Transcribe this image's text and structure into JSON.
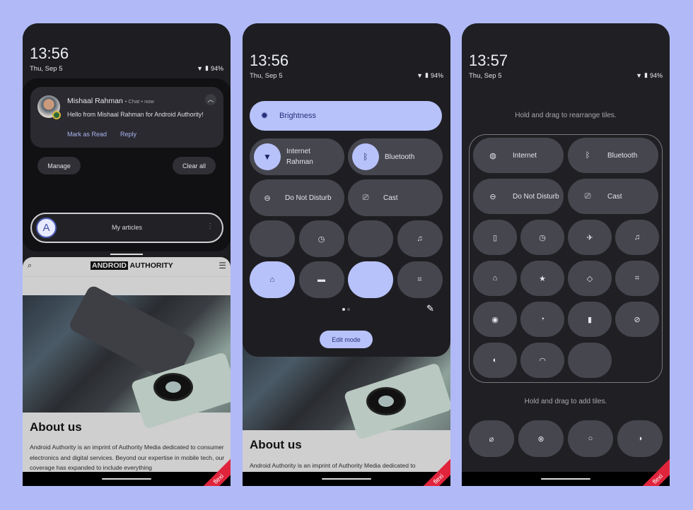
{
  "colors": {
    "background": "#b1baf6",
    "tile_inactive": "#46464f",
    "tile_active": "#b8c2fa",
    "panel": "#1d1d21"
  },
  "panel1": {
    "time": "13:56",
    "date": "Thu, Sep 5",
    "battery": "94%",
    "notification": {
      "sender": "Mishaal Rahman",
      "meta": "• Chat • now",
      "message": "Hello from Mishaal Rahman for Android Authority!",
      "actions": [
        "Mark as Read",
        "Reply"
      ]
    },
    "manage_label": "Manage",
    "clear_all_label": "Clear all",
    "bubble": {
      "label": "My articles"
    },
    "web": {
      "logo_left": "ANDROID",
      "logo_right": "AUTHORITY",
      "heading": "About us",
      "body": "Android Authority is an imprint of Authority Media dedicated to consumer electronics and digital services. Beyond our expertise in mobile tech, our coverage has expanded to include everything"
    },
    "watermark": "flexi"
  },
  "panel2": {
    "time": "13:56",
    "date": "Thu, Sep 5",
    "battery": "94%",
    "brightness_label": "Brightness",
    "large_tiles": [
      {
        "label": "Internet",
        "sub": "Rahman",
        "icon": "wifi-icon",
        "active": true
      },
      {
        "label": "Bluetooth",
        "sub": "",
        "icon": "bluetooth-icon",
        "active": true
      },
      {
        "label": "Do Not Disturb",
        "sub": "",
        "icon": "do-not-disturb-icon",
        "active": false
      },
      {
        "label": "Cast",
        "sub": "",
        "icon": "cast-icon",
        "active": false
      }
    ],
    "small_tiles": [
      {
        "icon": "",
        "active": false
      },
      {
        "icon": "alarm-icon",
        "active": false
      },
      {
        "icon": "",
        "active": false
      },
      {
        "icon": "notification-bell-icon",
        "active": false
      },
      {
        "icon": "home-icon",
        "active": true
      },
      {
        "icon": "wallet-icon",
        "active": false
      },
      {
        "icon": "",
        "active": true
      },
      {
        "icon": "qr-scanner-icon",
        "active": false
      }
    ],
    "page_indicator": {
      "pages": 2,
      "current": 1
    },
    "edit_mode_label": "Edit mode",
    "web": {
      "heading": "About us",
      "body": "Android Authority is an imprint of Authority Media dedicated to"
    },
    "watermark": "flexi"
  },
  "panel3": {
    "time": "13:57",
    "date": "Thu, Sep 5",
    "battery": "94%",
    "rearrange_hint": "Hold and drag to rearrange tiles.",
    "add_hint": "Hold and drag to add tiles.",
    "large_tiles": [
      {
        "label": "Internet",
        "icon": "globe-question-icon"
      },
      {
        "label": "Bluetooth",
        "icon": "bluetooth-icon"
      },
      {
        "label": "Do Not Disturb",
        "icon": "do-not-disturb-icon"
      },
      {
        "label": "Cast",
        "icon": "cast-icon"
      }
    ],
    "small_tiles": [
      "flashlight-icon",
      "alarm-icon",
      "airplane-icon",
      "notification-bell-icon",
      "home-icon",
      "star-icon",
      "rotate-icon",
      "qr-scanner-icon",
      "screen-record-icon",
      "data-saver-icon",
      "battery-saver-icon",
      "camera-off-icon",
      "dark-theme-icon",
      "hotspot-icon",
      ""
    ],
    "available_tiles": [
      "mic-off-icon",
      "location-off-icon",
      "sync-icon",
      "contrast-icon"
    ],
    "watermark": "flexi"
  }
}
